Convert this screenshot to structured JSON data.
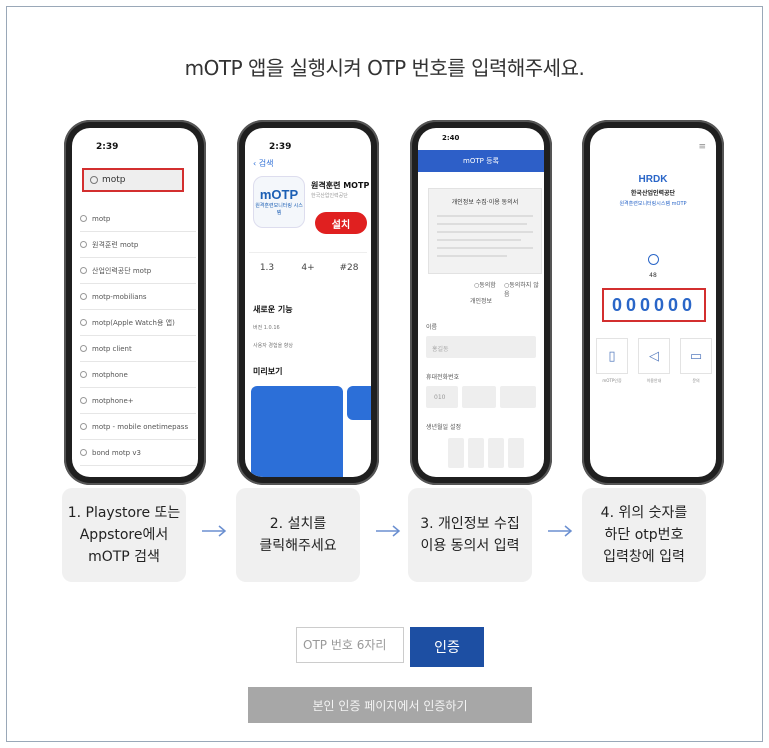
{
  "title": "mOTP 앱을 실행시켜 OTP 번호를 입력해주세요.",
  "phone1": {
    "time": "2:39",
    "search_query": "motp",
    "suggestions": [
      "motp",
      "원격훈련 motp",
      "산업인력공단 motp",
      "motp-mobilians",
      "motp(Apple Watch용 앱)",
      "motp client",
      "motphone",
      "motphone+",
      "motp - mobile onetimepass",
      "bond motp v3"
    ]
  },
  "phone2": {
    "time": "2:39",
    "back_label": "검색",
    "app_icon_text": "mOTP",
    "app_icon_sub": "원격훈련모니터링 시스템",
    "app_name": "원격훈련 MOTP",
    "app_sub": "한국산업인력공단",
    "install_label": "설치",
    "stats": [
      "1.3",
      "4+",
      "#28"
    ],
    "new_features_title": "새로운 기능",
    "new_features_sub": "버전 1.0.16",
    "new_features_note": "사용자 경험을 향상",
    "preview_title": "미리보기"
  },
  "phone3": {
    "time": "2:40",
    "header_title": "mOTP 등록",
    "consent_title": "개인정보 수집·이용 동의서",
    "agree_label": "동의함",
    "disagree_label": "동의하지 않음",
    "section_title": "개인정보",
    "name_label": "이름",
    "name_placeholder": "홍길동",
    "phone_label": "휴대전화번호",
    "phone_value": "010",
    "birth_label": "생년월일 설정"
  },
  "phone4": {
    "logo": "HRDK",
    "org_name": "한국산업인력공단",
    "system_name": "원격훈련모니터링시스템 mOTP",
    "seconds": "48",
    "otp": "000000",
    "tools": [
      "mOTP인증",
      "이용안내",
      "문의"
    ]
  },
  "steps": [
    {
      "line1": "1. Playstore 또는",
      "line2": "Appstore에서",
      "line3": "mOTP 검색"
    },
    {
      "line1": "2. 설치를",
      "line2": "클릭해주세요",
      "line3": ""
    },
    {
      "line1": "3. 개인정보 수집",
      "line2": "이용 동의서 입력",
      "line3": ""
    },
    {
      "line1": "4. 위의 숫자를",
      "line2": "하단 otp번호",
      "line3": "입력창에 입력"
    }
  ],
  "form": {
    "otp_placeholder": "OTP 번호 6자리",
    "verify_label": "인증",
    "alt_label": "본인 인증 페이지에서 인증하기"
  }
}
